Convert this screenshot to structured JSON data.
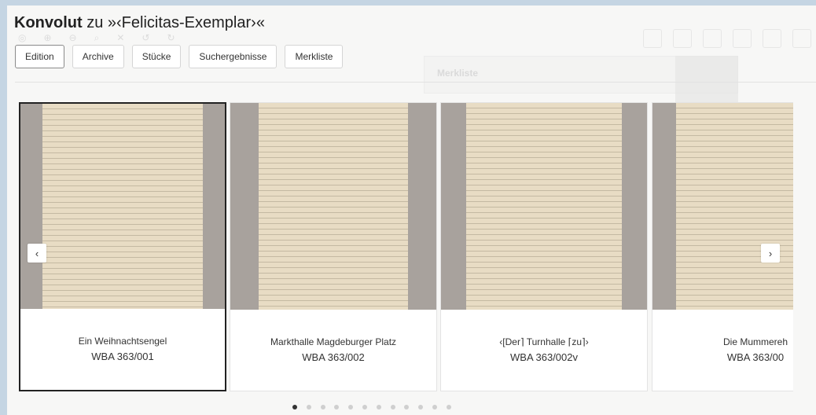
{
  "title": {
    "bold": "Konvolut",
    "rest": " zu »‹Felicitas-Exemplar›«"
  },
  "tabs": [
    {
      "label": "Edition",
      "active": true
    },
    {
      "label": "Archive",
      "active": false
    },
    {
      "label": "Stücke",
      "active": false
    },
    {
      "label": "Suchergebnisse",
      "active": false
    },
    {
      "label": "Merkliste",
      "active": false
    }
  ],
  "background_panel": {
    "title": "Merkliste"
  },
  "cards": [
    {
      "title": "Ein Weihnachtsengel",
      "signature": "WBA 363/001",
      "selected": true
    },
    {
      "title": "Markthalle Magdeburger Platz",
      "signature": "WBA 363/002",
      "selected": false
    },
    {
      "title": "‹[Der⌉ Turnhalle ⌈zu⌉›",
      "signature": "WBA 363/002v",
      "selected": false
    },
    {
      "title": "Die Mummereh",
      "signature": "WBA 363/00",
      "selected": false
    }
  ],
  "carousel": {
    "prev_icon": "‹",
    "next_icon": "›",
    "page_count": 12,
    "active_page": 1
  },
  "colors": {
    "page_background": "#c5d5e3",
    "thumb_background": "#a8a29d",
    "paper": "#e8dcc4",
    "active_dot": "#333333"
  }
}
